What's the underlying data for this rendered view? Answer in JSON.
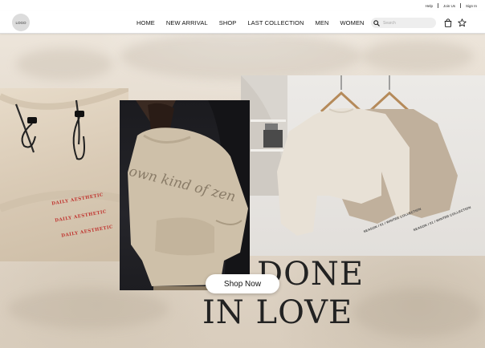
{
  "topbar": {
    "links": [
      "Help",
      "Join Us",
      "Sign In"
    ]
  },
  "navbar": {
    "logo_text": "LOGO",
    "links": [
      "HOME",
      "NEW ARRIVAL",
      "SHOP",
      "LAST COLLECTION",
      "MEN",
      "WOMEN"
    ],
    "search_placeholder": "Search",
    "icons": [
      "search-icon",
      "bag-icon",
      "star-icon"
    ]
  },
  "hero": {
    "hoodie_detail_print": [
      "DAILY AESTHETIC",
      "DAILY AESTHETIC",
      "DAILY AESTHETIC"
    ],
    "model_hoodie_text": "own kind of zen",
    "sleeve_print_left": "SEASON / 01 / WINTER COLLECTION",
    "sleeve_print_right": "SEASON / 01 / WINTER COLLECTION",
    "slogan_line1": "DONE",
    "slogan_line2": "IN LOVE",
    "cta_label": "Shop Now"
  },
  "colors": {
    "background": "#e6ddd1",
    "nav_bg": "#ffffff",
    "print_red": "#c0342f",
    "text_dark": "#111111"
  }
}
